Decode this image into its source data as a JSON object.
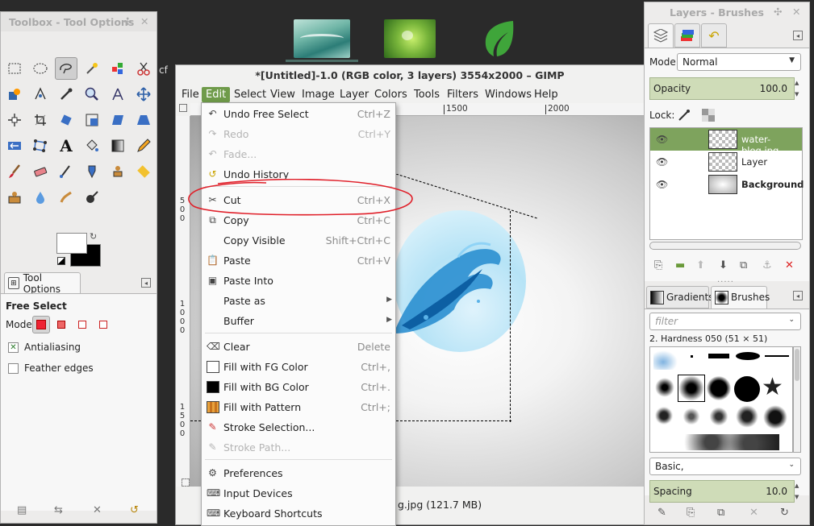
{
  "desktop": {
    "side_text": "cf"
  },
  "toolbox": {
    "title": "Toolbox - Tool Options",
    "tool_options_tab": "Tool Options",
    "tool_name": "Free Select",
    "mode_label": "Mode:",
    "antialiasing": "Antialiasing",
    "feather_edges": "Feather edges"
  },
  "image_window": {
    "title": "*[Untitled]-1.0 (RGB color, 3 layers) 3554x2000 – GIMP",
    "menus": [
      "File",
      "Edit",
      "Select",
      "View",
      "Image",
      "Layer",
      "Colors",
      "Tools",
      "Filters",
      "Windows",
      "Help"
    ],
    "ruler_ticks": [
      "1500",
      "2000"
    ],
    "left_ruler": [
      "5",
      "0",
      "0",
      "1",
      "0",
      "0",
      "0",
      "1",
      "5",
      "0",
      "0"
    ],
    "status": "g.jpg (121.7 MB)"
  },
  "edit_menu": {
    "items": [
      {
        "label": "Undo Free Select",
        "accel": "Ctrl+Z"
      },
      {
        "label": "Redo",
        "accel": "Ctrl+Y"
      },
      {
        "label": "Fade...",
        "accel": ""
      },
      {
        "label": "Undo History",
        "accel": ""
      },
      {
        "label": "Cut",
        "accel": "Ctrl+X"
      },
      {
        "label": "Copy",
        "accel": "Ctrl+C"
      },
      {
        "label": "Copy Visible",
        "accel": "Shift+Ctrl+C"
      },
      {
        "label": "Paste",
        "accel": "Ctrl+V"
      },
      {
        "label": "Paste Into",
        "accel": ""
      },
      {
        "label": "Paste as",
        "accel": ""
      },
      {
        "label": "Buffer",
        "accel": ""
      },
      {
        "label": "Clear",
        "accel": "Delete"
      },
      {
        "label": "Fill with FG Color",
        "accel": "Ctrl+,"
      },
      {
        "label": "Fill with BG Color",
        "accel": "Ctrl+."
      },
      {
        "label": "Fill with Pattern",
        "accel": "Ctrl+;"
      },
      {
        "label": "Stroke Selection...",
        "accel": ""
      },
      {
        "label": "Stroke Path...",
        "accel": ""
      },
      {
        "label": "Preferences",
        "accel": ""
      },
      {
        "label": "Input Devices",
        "accel": ""
      },
      {
        "label": "Keyboard Shortcuts",
        "accel": ""
      }
    ]
  },
  "layers_dock": {
    "title": "Layers - Brushes",
    "mode_label": "Mode:",
    "mode_value": "Normal",
    "opacity_label": "Opacity",
    "opacity_value": "100.0",
    "lock_label": "Lock:",
    "layers": [
      {
        "name": "water-blog.jpg"
      },
      {
        "name": "Layer"
      },
      {
        "name": "Background"
      }
    ],
    "tab_gradients": "Gradients",
    "tab_brushes": "Brushes",
    "filter_placeholder": "filter",
    "brush_name": "2. Hardness 050 (51 × 51)",
    "brush_set": "Basic,",
    "spacing_label": "Spacing",
    "spacing_value": "10.0"
  },
  "colors": {
    "accent": "#6f9b4a",
    "fg": "#ffffff",
    "bg": "#000000",
    "annotation": "#e0202a"
  }
}
